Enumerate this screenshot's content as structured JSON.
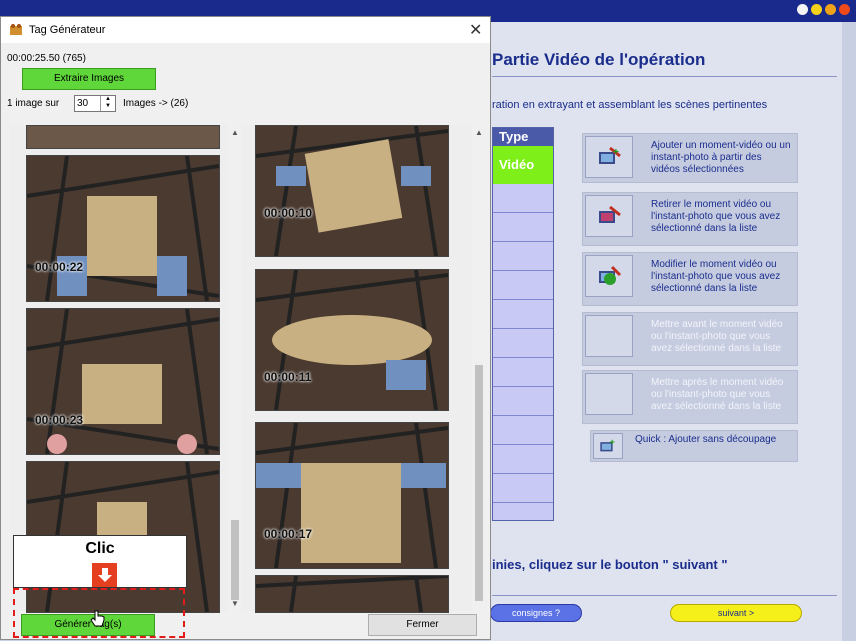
{
  "right": {
    "title": "Partie Vidéo de l'opération",
    "subtitle": "ration en extrayant et assemblant les scènes pertinentes",
    "type_header": "Type",
    "type_value": "Vidéo",
    "footer_text": "inies, cliquez sur le bouton \" suivant \"",
    "consignes_label": "consignes ?",
    "suivant_label": "suivant >",
    "actions": [
      {
        "text": "Ajouter un moment-vidéo ou un instant-photo à partir des vidéos sélectionnées",
        "icon": "add-clip-icon"
      },
      {
        "text": "Retirer le moment vidéo ou l'instant-photo que vous avez sélectionné dans la liste",
        "icon": "remove-clip-icon"
      },
      {
        "text": "Modifier le moment vidéo ou l'instant-photo que vous avez sélectionné dans la liste",
        "icon": "edit-clip-icon"
      },
      {
        "text": "Mettre avant le moment vidéo ou l'instant-photo que vous avez sélectionné dans la liste",
        "icon": ""
      },
      {
        "text": "Mettre après le moment vidéo ou l'instant-photo que vous avez sélectionné dans la liste",
        "icon": ""
      },
      {
        "text": "Quick : Ajouter sans découpage",
        "icon": "quick-add-icon"
      }
    ]
  },
  "dialog": {
    "title": "Tag Générateur",
    "close": "✕",
    "time_info": "00:00:25.50 (765)",
    "extract_label": "Extraire Images",
    "image_label": "1 image sur",
    "image_value": "30",
    "image_count": "Images -> (26)",
    "generate_label": "Générer Tag(s)",
    "close_label": "Fermer"
  },
  "frames": {
    "left": [
      "00:00:22",
      "00:00:23",
      ""
    ],
    "right": [
      "00:00:10",
      "00:00:11",
      "00:00:17",
      ""
    ]
  },
  "callout": {
    "text": "Clic"
  },
  "colors": {
    "accent": "#1a2d8c",
    "green": "#7fef1a",
    "callout_red": "#e21b1b"
  }
}
